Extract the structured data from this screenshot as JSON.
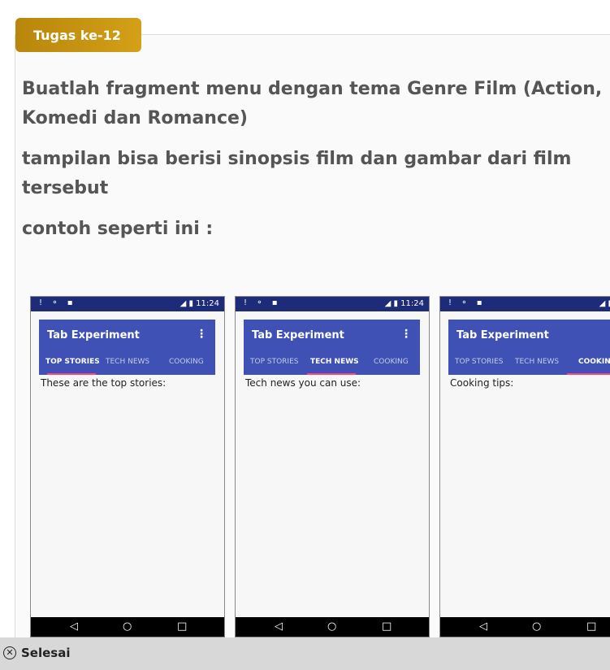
{
  "task": {
    "badge": "Tugas ke-12",
    "paragraphs": [
      "Buatlah fragment menu dengan tema Genre Film (Action, Komedi dan Romance)",
      "tampilan bisa berisi sinopsis film dan gambar dari film tersebut",
      "contoh seperti ini :"
    ]
  },
  "phones": [
    {
      "status_left": "! ⚬ ▪",
      "status_right": "◢ ▮ 11:24",
      "title": "Tab Experiment",
      "tabs": [
        "TOP STORIES",
        "TECH NEWS",
        "COOKING"
      ],
      "active_tab": 0,
      "content": "These are the top stories:"
    },
    {
      "status_left": "! ⚬ ▪",
      "status_right": "◢ ▮ 11:24",
      "title": "Tab Experiment",
      "tabs": [
        "TOP STORIES",
        "TECH NEWS",
        "COOKING"
      ],
      "active_tab": 1,
      "content": "Tech news you can use:"
    },
    {
      "status_left": "! ⚬ ▪",
      "status_right": "◢ ▮",
      "title": "Tab Experiment",
      "tabs": [
        "TOP STORIES",
        "TECH NEWS",
        "COOKIN"
      ],
      "active_tab": 2,
      "content": "Cooking tips:"
    }
  ],
  "nav": {
    "back": "◁",
    "home": "○",
    "recent": "□"
  },
  "footer": {
    "icon": "close-circle-icon",
    "label": "Selesai"
  },
  "colors": {
    "badge": "#c9961a",
    "appbar": "#3f51b5",
    "statusbar": "#1d2b78",
    "indicator": "#ff4081"
  }
}
